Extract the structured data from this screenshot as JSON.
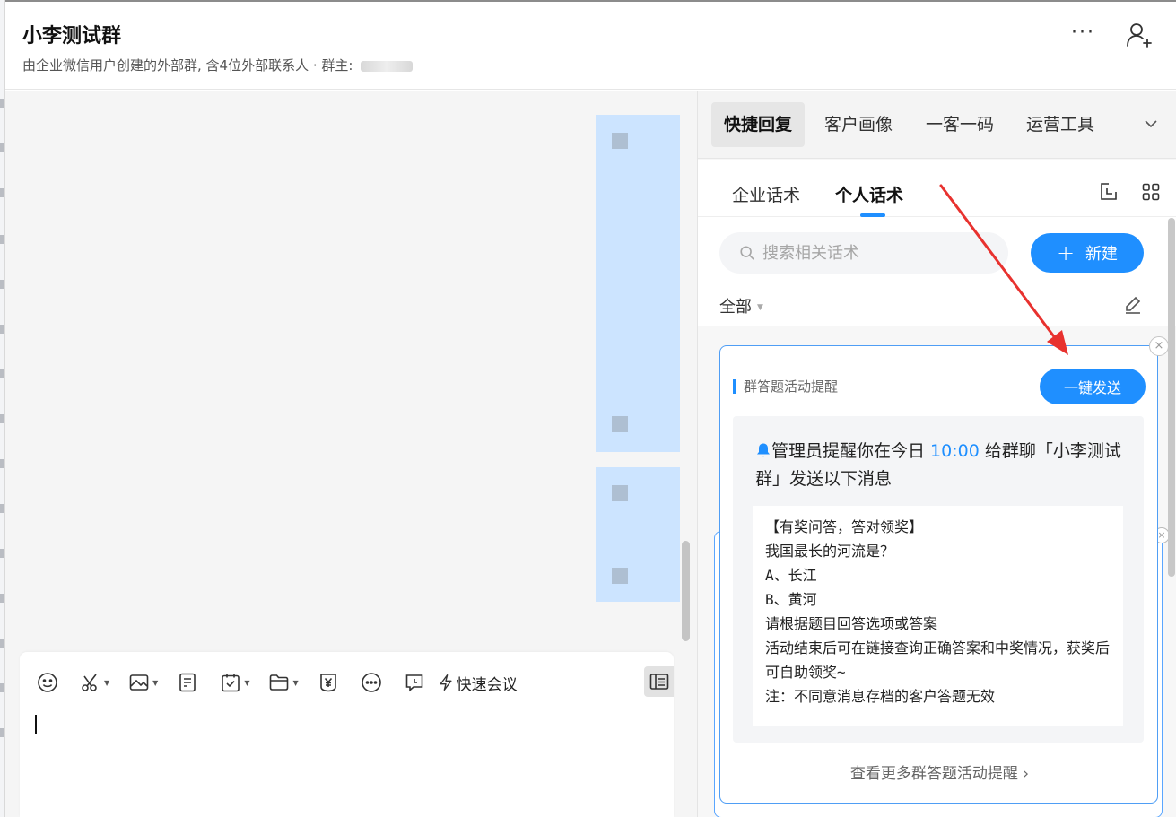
{
  "header": {
    "title": "小李测试群",
    "subtitle": "由企业微信用户创建的外部群, 含4位外部联系人 · 群主: ",
    "more_label": "···"
  },
  "composer": {
    "quick_meeting_label": "快速会议"
  },
  "panel": {
    "top_tabs": [
      "快捷回复",
      "客户画像",
      "一客一码",
      "运营工具"
    ],
    "active_top_tab": "快捷回复",
    "sub_tabs": [
      "企业话术",
      "个人话术"
    ],
    "active_sub_tab": "个人话术",
    "search_placeholder": "搜索相关话术",
    "new_button_label": "新建",
    "new_button_plus": "+",
    "filter_label": "全部",
    "card": {
      "label": "群答题活动提醒",
      "send_button": "一键发送",
      "notice_prefix": "管理员提醒你在今日 ",
      "notice_time": "10:00",
      "notice_suffix": " 给群聊「小李测试群」发送以下消息",
      "message": "【有奖问答，答对领奖】\n我国最长的河流是？\nA、长江\nB、黄河\n请根据题目回答选项或答案\n活动结束后可在链接查询正确答案和中奖情况，获奖后可自助领奖~\n注：不同意消息存档的客户答题无效",
      "more_link": "查看更多群答题活动提醒 ›",
      "close_symbol": "×"
    }
  },
  "colors": {
    "accent": "#1f8fff",
    "annotation_arrow": "#e8322f",
    "chat_bubble": "#cce4ff"
  }
}
